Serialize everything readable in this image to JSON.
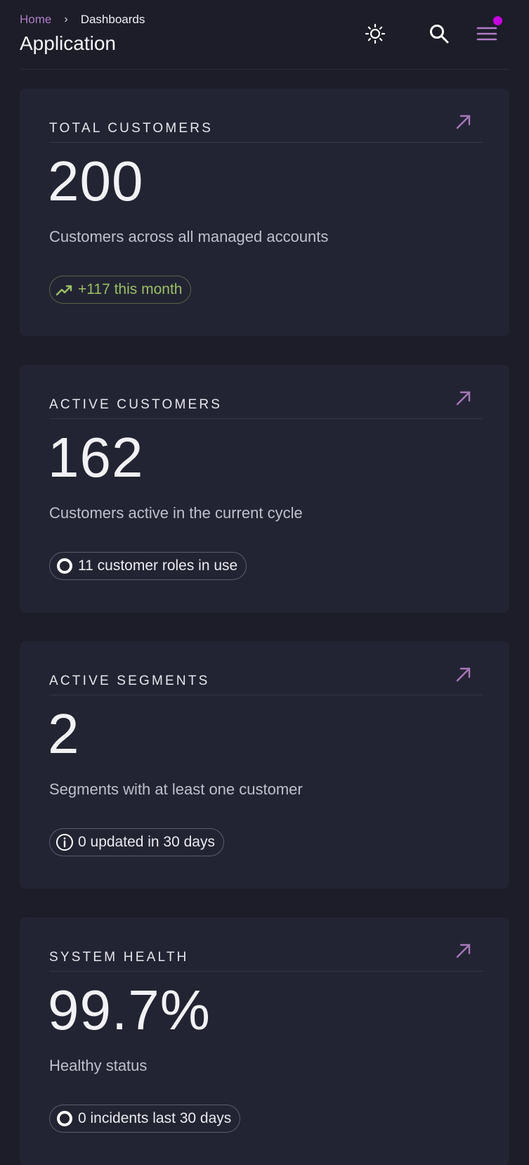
{
  "header": {
    "breadcrumb": {
      "home": "Home",
      "current": "Dashboards"
    },
    "title": "Application",
    "icons": [
      "brightness-icon",
      "search-icon",
      "menu-icon"
    ],
    "accent": "#b07cc6",
    "notification_color": "#c800e0"
  },
  "cards": [
    {
      "title": "TOTAL CUSTOMERS",
      "value": "200",
      "desc": "Customers across all managed accounts",
      "pill": "+117 this month",
      "pill_icon": "trending-up-icon"
    },
    {
      "title": "ACTIVE CUSTOMERS",
      "value": "162",
      "desc": "Customers active in the current cycle",
      "pill": "11 customer roles in use",
      "pill_icon": "ring-icon"
    },
    {
      "title": "ACTIVE SEGMENTS",
      "value": "2",
      "desc": "Segments with at least one customer",
      "pill": "0 updated in 30 days",
      "pill_icon": "info-icon"
    },
    {
      "title": "SYSTEM HEALTH",
      "value": "99.7%",
      "desc": "Healthy status",
      "pill": "0 incidents last 30 days",
      "pill_icon": "ring-icon"
    }
  ]
}
